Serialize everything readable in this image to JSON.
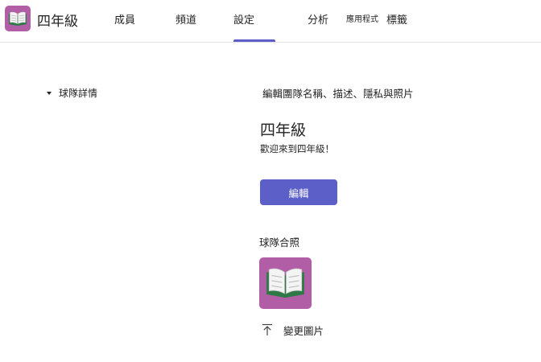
{
  "header": {
    "team_name": "四年級",
    "tabs": [
      {
        "label": "成員"
      },
      {
        "label": "頻道"
      },
      {
        "label": "設定"
      },
      {
        "label": "分析"
      },
      {
        "label": "應用程式"
      },
      {
        "label": "標籤"
      }
    ],
    "active_tab": "設定"
  },
  "sidebar": {
    "section_label": "球隊詳情",
    "toggle_icon": "caret-down-icon"
  },
  "details": {
    "subtitle": "編輯團隊名稱、描述、隱私與照片",
    "team_name": "四年級",
    "welcome": "歡迎來到四年級！",
    "edit_label": "編輯",
    "photo_label": "球隊合照",
    "photo_icon": "open-book-icon",
    "change_photo_label": "變更圖片",
    "change_photo_icon": "upload-arrow-icon"
  },
  "colors": {
    "accent": "#5b5fc7",
    "avatar_bg": "#b15ea6",
    "book_cover": "#2d7a47"
  }
}
